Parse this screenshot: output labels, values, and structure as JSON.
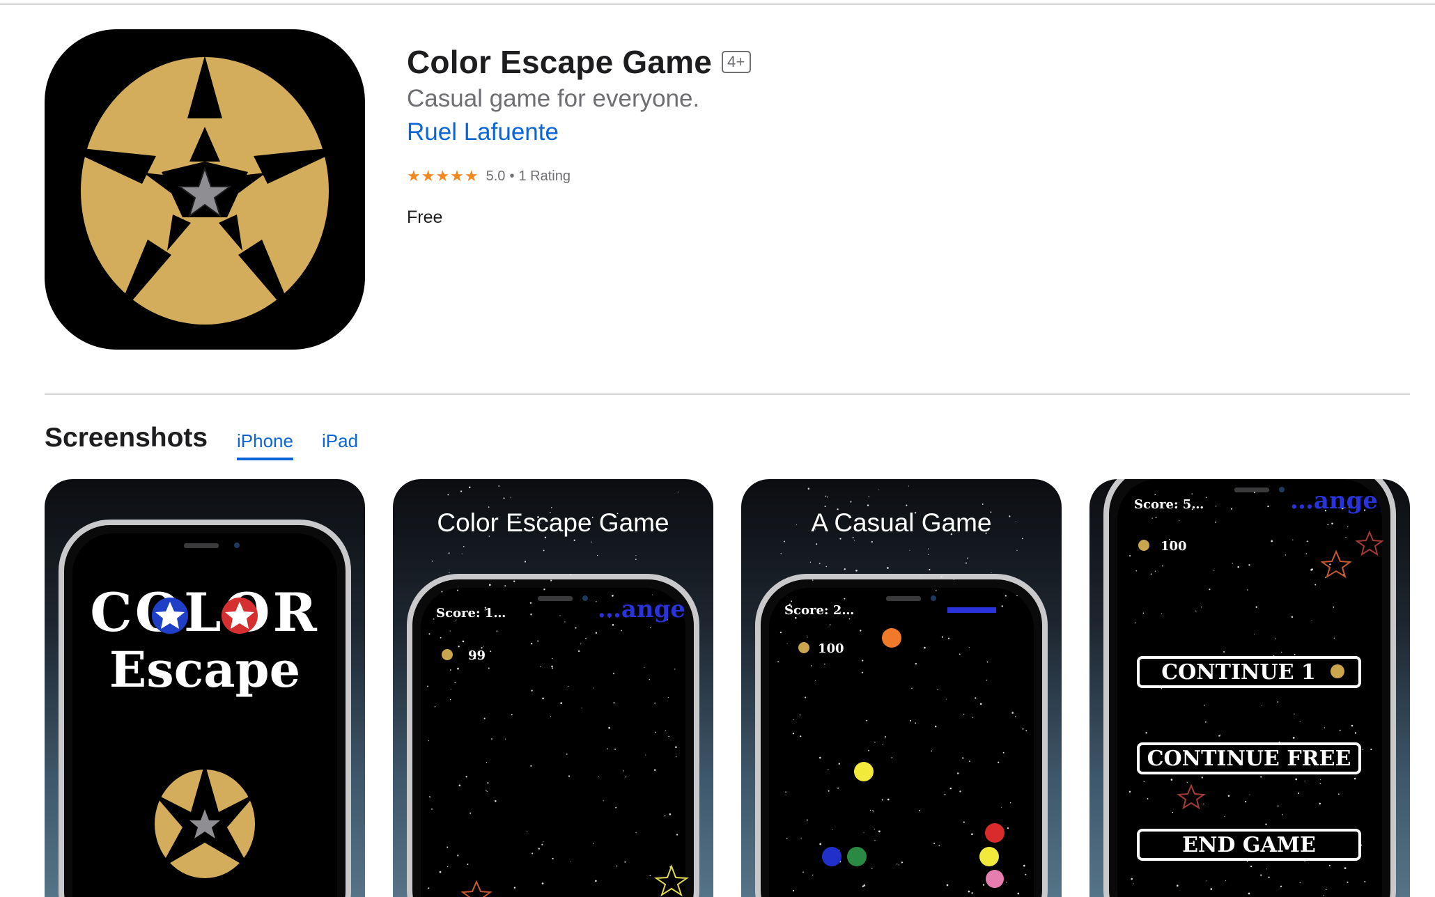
{
  "app": {
    "title": "Color Escape Game",
    "age_rating": "4+",
    "subtitle": "Casual game for everyone.",
    "developer": "Ruel Lafuente",
    "stars": "★★★★★",
    "rating_value": "5.0",
    "rating_count": "1 Rating",
    "price": "Free",
    "icon_colors": {
      "gold": "#d4ad5c",
      "star": "#8e8e93"
    }
  },
  "screenshots": {
    "heading": "Screenshots",
    "tabs": [
      {
        "label": "iPhone",
        "active": true
      },
      {
        "label": "iPad",
        "active": false
      }
    ],
    "items": [
      {
        "caption": "",
        "logo_line1": "COLOR",
        "logo_line2": "Escape"
      },
      {
        "caption": "Color Escape Game",
        "score": "Score: 1…",
        "coins": "99",
        "mode": "…ange"
      },
      {
        "caption": "A Casual Game",
        "score": "Score: 2…",
        "coins": "100"
      },
      {
        "caption": "",
        "score": "Score: 5…",
        "coins": "100",
        "mode": "…ange",
        "buttons": [
          "CONTINUE 1",
          "CONTINUE FREE",
          "END GAME"
        ]
      }
    ]
  }
}
